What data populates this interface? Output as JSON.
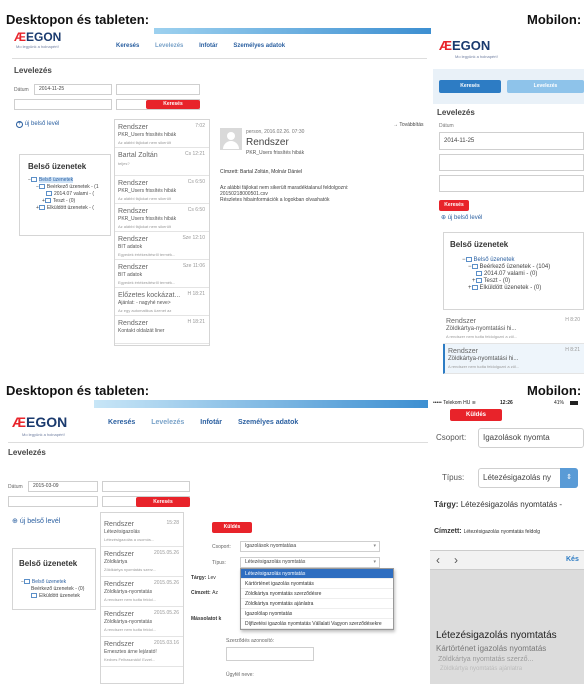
{
  "headers": {
    "desktop": "Desktopon és tableten:",
    "mobile": "Mobilon:"
  },
  "brand": {
    "logo": "EGON",
    "tagline": "Mo legyünk a holnapért!"
  },
  "nav": [
    "Keresés",
    "Levelezés",
    "Infotár",
    "Személyes adatok"
  ],
  "s1": {
    "title": "Levelezés",
    "date_label": "Dátum",
    "date_value": "2014-11-25",
    "search_btn": "Keresés",
    "new_msg": "új belső levél",
    "forward": "Továbbítás",
    "tree_title": "Belső üzenetek",
    "tree": [
      "Belső üzenetek",
      "Beérkező üzenetek - (1",
      "2014.07 valami - (",
      "Teszt - (0)",
      "Elküldött üzenetek - ("
    ],
    "messages": [
      {
        "from": "Rendszer",
        "subj": "PKR_Users frissítés hibák",
        "body": "Az alábbi fájlokat nem sikerült",
        "date": "7:02"
      },
      {
        "from": "Bartal Zoltán",
        "subj": "",
        "body": "teljes?",
        "date": "Cs 12:21"
      },
      {
        "from": "Rendszer",
        "subj": "PKR_Users frissítés hibák",
        "body": "Az alábbi fájlokat nem sikerült",
        "date": "Cs 6:50"
      },
      {
        "from": "Rendszer",
        "subj": "PKR_Users frissítés hibák",
        "body": "Az alábbi fájlokat nem sikerült",
        "date": "Cs 6:50"
      },
      {
        "from": "Rendszer",
        "subj": "BIT adatok",
        "body": "Egyedek értékesítésről termék...",
        "date": "Sze 12:10"
      },
      {
        "from": "Rendszer",
        "subj": "BIT adatok",
        "body": "Egyedek értékesítésről termék...",
        "date": "Sze 11:06"
      },
      {
        "from": "Előzetes kockázat...",
        "subj": "Ajánlat: - nagyhé neve>",
        "body": "Az egy automatikus üzenet az",
        "date": "H 18:21"
      },
      {
        "from": "Rendszer",
        "subj": "Kontakt oldalzát liner",
        "body": "",
        "date": "H 18:21"
      }
    ],
    "detail": {
      "meta": "person, 2016.02.26. 07:30",
      "from": "Rendszer",
      "subj": "PKR_Users frissítés hibák",
      "recip": "Címzett: Bartal Zoltán, Molnár Dániel",
      "body1": "Az alábbi fájlokat nem sikerült maradéktalanul feldolgozni:",
      "body2": "20150218000501.csv",
      "body3": "Részletes hibainformációk a logokban olvashatók"
    }
  },
  "m1": {
    "btn1": "Keresés",
    "btn2": "Levelezés",
    "title": "Levelezés",
    "date_label": "Dátum",
    "date_value": "2014-11-25",
    "search_btn": "Keresés",
    "new_msg": "új belső levél",
    "tree_title": "Belső üzenetek",
    "tree": [
      "Belső üzenetek",
      "Beérkező üzenetek - (104)",
      "2014.07 valami - (0)",
      "Teszt - (0)",
      "Elküldött üzenetek - (0)"
    ],
    "messages": [
      {
        "from": "Rendszer",
        "subj": "Zöldkártya-nyomtatási hi...",
        "body": "A rendszer nem tudta feldolgozni a zöl...",
        "date": "H 8:20"
      },
      {
        "from": "Rendszer",
        "subj": "Zöldkártya-nyomtatási hi...",
        "body": "A rendszer nem tudta feldolgozni a zöl...",
        "date": "H 8:21"
      }
    ]
  },
  "s2": {
    "title": "Levelezés",
    "date_label": "Dátum",
    "date_value": "2015-03-09",
    "search_btn": "Keresés",
    "new_msg": "új belső levél",
    "tree_title": "Belső üzenetek",
    "tree": [
      "Belső üzenetek",
      "Beérkező üzenetek - (0)",
      "Elküldött üzenetek"
    ],
    "messages": [
      {
        "from": "Rendszer",
        "subj": "Létezésigazolás",
        "body": "Létezésigazolás a csomós...",
        "date": "15:28"
      },
      {
        "from": "Rendszer",
        "subj": "Zöldkártya",
        "body": "Zöldkártya nyomtatás szerz...",
        "date": "2015.05.26"
      },
      {
        "from": "Rendszer",
        "subj": "Zöldkártya-nyomtatás",
        "body": "A rendszer nem tudta feldol...",
        "date": "2015.05.26"
      },
      {
        "from": "Rendszer",
        "subj": "Zöldkártya-nyomtatás",
        "body": "A rendszer nem tudta feldol...",
        "date": "2015.05.26"
      },
      {
        "from": "Rendszer",
        "subj": "Ernesztes árne lejárató!",
        "body": "Kedves Felhasználó! Ezzel...",
        "date": "2015.03.16"
      }
    ],
    "form": {
      "send_btn": "Küldés",
      "group_label": "Csoport:",
      "group_value": "Igazolások nyomtatása",
      "type_label": "Típus:",
      "type_value": "Létezésigazolás nyomtatás",
      "subject_label": "Tárgy:",
      "subject_value": "Lev",
      "recipient_label": "Címzett:",
      "recipient_value": "Az",
      "extra_label": "Mássolatot k",
      "contract_label": "Szerződés azonosító:",
      "client_label": "Ügyfél neve:",
      "options": [
        "Létezésigazolás nyomtatás",
        "Kártörténet igazolás nyomtatás",
        "Zöldkártya nyomtatás szerződésre",
        "Zöldkártya nyomtatás ajánlatra",
        "Igazolólap nyomtatás",
        "Díjfizetési igazolás nyomtatás Vállalati Vagyon szerződésekre"
      ]
    }
  },
  "m2": {
    "carrier": "Telekom HU",
    "time": "12:26",
    "battery": "41%",
    "send_btn": "Küldés",
    "group_label": "Csoport:",
    "group_value": "Igazolások nyomta",
    "type_label": "Típus:",
    "type_value": "Létezésigazolás ny",
    "subject_label": "Tárgy:",
    "subject_value": "Létezésigazolás nyomtatás -",
    "recipient_label": "Címzett:",
    "recipient_value": "Létezésigazolás nyomtatás feldolg",
    "done": "Kés",
    "picker": [
      "Létezésigazolás nyomtatás",
      "Kártörténet igazolás nyomtatás",
      "Zöldkártya nyomtatás szerző...",
      "Zöldkártya nyomtatás ajánlatra"
    ]
  },
  "colors": {
    "red": "#e8232a",
    "blue": "#2d7cc4",
    "navy": "#1a3a6e"
  }
}
